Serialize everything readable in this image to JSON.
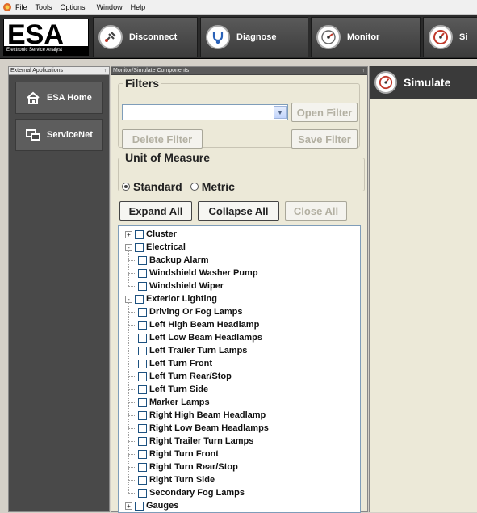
{
  "menu": {
    "items": [
      "File",
      "Tools",
      "Options",
      "Window",
      "Help"
    ]
  },
  "toolbar": {
    "logo_text": "ESA",
    "logo_subtext": "Electronic Service Analyst",
    "buttons": [
      {
        "label": "Disconnect",
        "icon": "disconnect-plug-icon"
      },
      {
        "label": "Diagnose",
        "icon": "stethoscope-icon"
      },
      {
        "label": "Monitor",
        "icon": "gauge-icon"
      },
      {
        "label": "Si",
        "icon": "gauge-red-icon"
      }
    ]
  },
  "left_panel": {
    "title": "External Applications",
    "pin_glyph": "↑",
    "items": [
      {
        "label": "ESA Home",
        "icon": "home-icon"
      },
      {
        "label": "ServiceNet",
        "icon": "network-icon"
      }
    ]
  },
  "mid_panel": {
    "title": "Monitor/Simulate Components",
    "pin_glyph": "↑",
    "filters": {
      "legend": "Filters",
      "combo_value": "",
      "open_filter": "Open Filter",
      "delete_filter": "Delete Filter",
      "save_filter": "Save Filter"
    },
    "unit_of_measure": {
      "legend": "Unit of Measure",
      "options": [
        "Standard",
        "Metric"
      ],
      "selected": "Standard"
    },
    "actions": {
      "expand_all": "Expand All",
      "collapse_all": "Collapse All",
      "close_all": "Close All"
    },
    "tree": [
      {
        "label": "Cluster",
        "level": 0,
        "expander": "+"
      },
      {
        "label": "Electrical",
        "level": 0,
        "expander": "-"
      },
      {
        "label": "Backup Alarm",
        "level": 1
      },
      {
        "label": "Windshield Washer Pump",
        "level": 1
      },
      {
        "label": "Windshield Wiper",
        "level": 1
      },
      {
        "label": "Exterior Lighting",
        "level": 0,
        "expander": "-"
      },
      {
        "label": "Driving Or Fog Lamps",
        "level": 1
      },
      {
        "label": "Left High Beam Headlamp",
        "level": 1
      },
      {
        "label": "Left Low Beam Headlamps",
        "level": 1
      },
      {
        "label": "Left Trailer Turn Lamps",
        "level": 1
      },
      {
        "label": "Left Turn Front",
        "level": 1
      },
      {
        "label": "Left Turn Rear/Stop",
        "level": 1
      },
      {
        "label": "Left Turn Side",
        "level": 1
      },
      {
        "label": "Marker Lamps",
        "level": 1
      },
      {
        "label": "Right High Beam Headlamp",
        "level": 1
      },
      {
        "label": "Right Low Beam Headlamps",
        "level": 1
      },
      {
        "label": "Right Trailer Turn Lamps",
        "level": 1
      },
      {
        "label": "Right Turn Front",
        "level": 1
      },
      {
        "label": "Right Turn Rear/Stop",
        "level": 1
      },
      {
        "label": "Right Turn Side",
        "level": 1
      },
      {
        "label": "Secondary Fog Lamps",
        "level": 1
      },
      {
        "label": "Gauges",
        "level": 0,
        "expander": "+"
      }
    ]
  },
  "right_panel": {
    "title": "Simulate",
    "icon": "gauge-red-icon"
  }
}
